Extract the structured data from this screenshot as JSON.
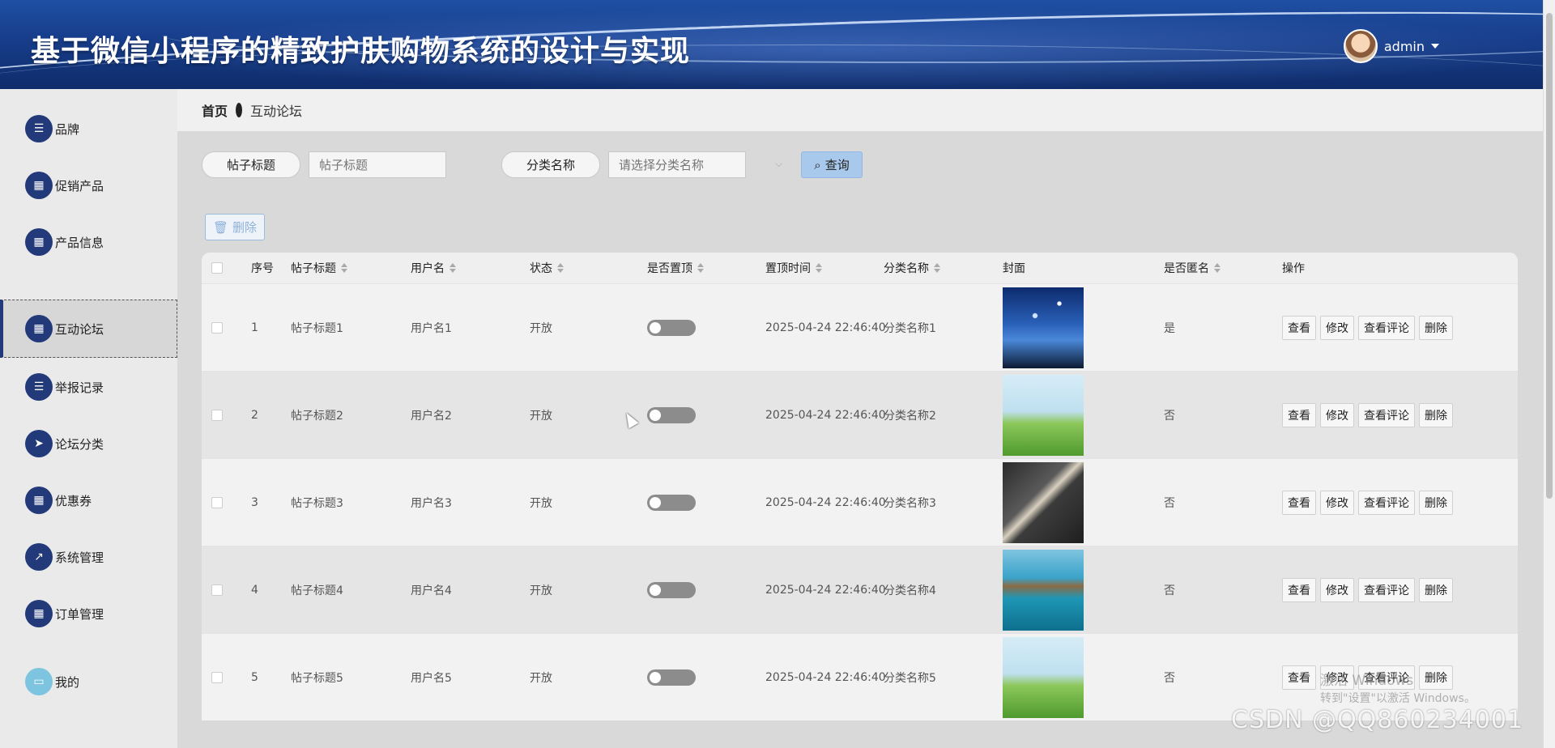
{
  "header": {
    "title": "基于微信小程序的精致护肤购物系统的设计与实现",
    "username": "admin"
  },
  "sidebar": {
    "items": [
      {
        "label": "品牌",
        "icon": "list-icon"
      },
      {
        "label": "促销产品",
        "icon": "grid-icon"
      },
      {
        "label": "产品信息",
        "icon": "grid-icon"
      },
      {
        "label": "互动论坛",
        "icon": "grid-icon",
        "active": true
      },
      {
        "label": "举报记录",
        "icon": "list-icon"
      },
      {
        "label": "论坛分类",
        "icon": "send-icon"
      },
      {
        "label": "优惠券",
        "icon": "grid-icon"
      },
      {
        "label": "系统管理",
        "icon": "chart-icon"
      },
      {
        "label": "订单管理",
        "icon": "grid-icon"
      },
      {
        "label": "我的",
        "icon": "card-icon"
      }
    ]
  },
  "breadcrumb": {
    "home": "首页",
    "current": "互动论坛"
  },
  "search": {
    "title_label": "帖子标题",
    "title_placeholder": "帖子标题",
    "category_label": "分类名称",
    "category_placeholder": "请选择分类名称",
    "query_label": "查询",
    "delete_label": "删除"
  },
  "table": {
    "headers": {
      "index": "序号",
      "title": "帖子标题",
      "username": "用户名",
      "status": "状态",
      "pinned": "是否置顶",
      "pin_time": "置顶时间",
      "category": "分类名称",
      "cover": "封面",
      "anonymous": "是否匿名",
      "actions": "操作"
    },
    "action_labels": {
      "view": "查看",
      "edit": "修改",
      "comments": "查看评论",
      "delete": "删除"
    },
    "rows": [
      {
        "index": "1",
        "title": "帖子标题1",
        "username": "用户名1",
        "status": "开放",
        "pinned": false,
        "pin_time": "2025-04-24 22:46:40",
        "category": "分类名称1",
        "cover": "starry-night",
        "anonymous": "是"
      },
      {
        "index": "2",
        "title": "帖子标题2",
        "username": "用户名2",
        "status": "开放",
        "pinned": false,
        "pin_time": "2025-04-24 22:46:40",
        "category": "分类名称2",
        "cover": "green-meadow",
        "anonymous": "否"
      },
      {
        "index": "3",
        "title": "帖子标题3",
        "username": "用户名3",
        "status": "开放",
        "pinned": false,
        "pin_time": "2025-04-24 22:46:40",
        "category": "分类名称3",
        "cover": "open-book",
        "anonymous": "否"
      },
      {
        "index": "4",
        "title": "帖子标题4",
        "username": "用户名4",
        "status": "开放",
        "pinned": false,
        "pin_time": "2025-04-24 22:46:40",
        "category": "分类名称4",
        "cover": "sea-rock",
        "anonymous": "否"
      },
      {
        "index": "5",
        "title": "帖子标题5",
        "username": "用户名5",
        "status": "开放",
        "pinned": false,
        "pin_time": "2025-04-24 22:46:40",
        "category": "分类名称5",
        "cover": "green-meadow",
        "anonymous": "否"
      }
    ]
  },
  "overlay": {
    "activate_title": "激活 Windows",
    "activate_sub": "转到\"设置\"以激活 Windows。",
    "csdn": "CSDN @QQ860234001"
  },
  "colors": {
    "header_blue": "#173d8a",
    "sidebar_icon": "#233a7a",
    "query_button": "#a8c8ec",
    "toggle_off": "#8c8c8c"
  }
}
